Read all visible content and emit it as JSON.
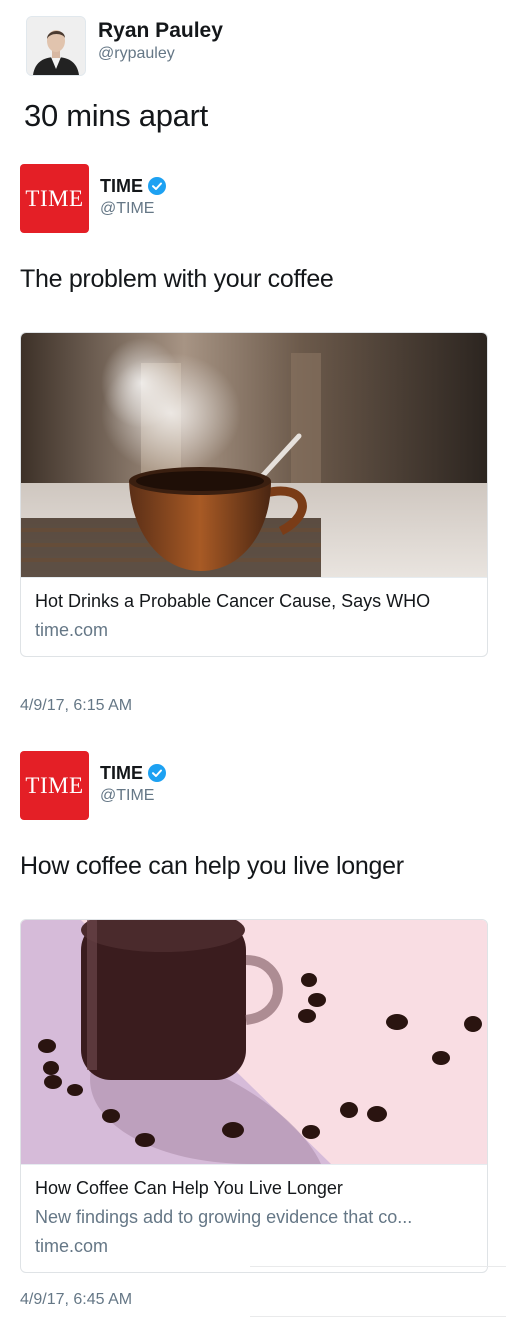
{
  "author": {
    "name": "Ryan Pauley",
    "handle": "@rypauley"
  },
  "caption": "30 mins apart",
  "tweets": [
    {
      "logo_text": "TIME",
      "name": "TIME",
      "handle": "@TIME",
      "verified": true,
      "text": "The problem with your coffee",
      "card": {
        "title": "Hot Drinks a Probable Cancer Cause, Says WHO",
        "description": "",
        "domain": "time.com"
      },
      "timestamp": "4/9/17, 6:15 AM"
    },
    {
      "logo_text": "TIME",
      "name": "TIME",
      "handle": "@TIME",
      "verified": true,
      "text": "How coffee can help you live longer",
      "card": {
        "title": "How Coffee Can Help You Live Longer",
        "description": "New findings add to growing evidence that co...",
        "domain": "time.com"
      },
      "timestamp": "4/9/17, 6:45 AM"
    }
  ],
  "colors": {
    "brand_red": "#e41f26",
    "verified_blue": "#1da1f2",
    "secondary_text": "#657786"
  }
}
